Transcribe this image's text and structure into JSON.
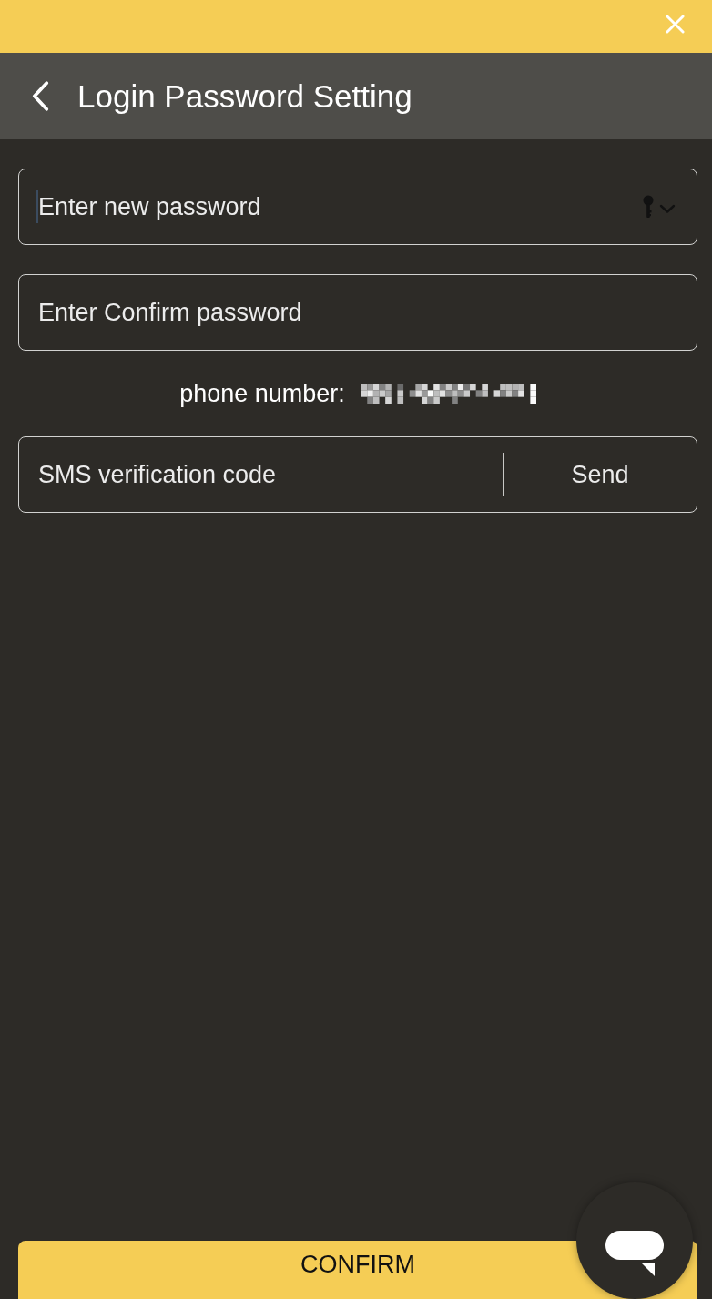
{
  "header": {
    "title": "Login Password Setting"
  },
  "fields": [
    {
      "placeholder": "Enter new password",
      "focused": true,
      "key_menu": true
    },
    {
      "placeholder": "Enter Confirm password",
      "focused": false,
      "key_menu": false
    }
  ],
  "phone": {
    "label": "phone number:"
  },
  "sms": {
    "placeholder": "SMS verification code",
    "button": "Send"
  },
  "confirm_button": "CONFIRM"
}
